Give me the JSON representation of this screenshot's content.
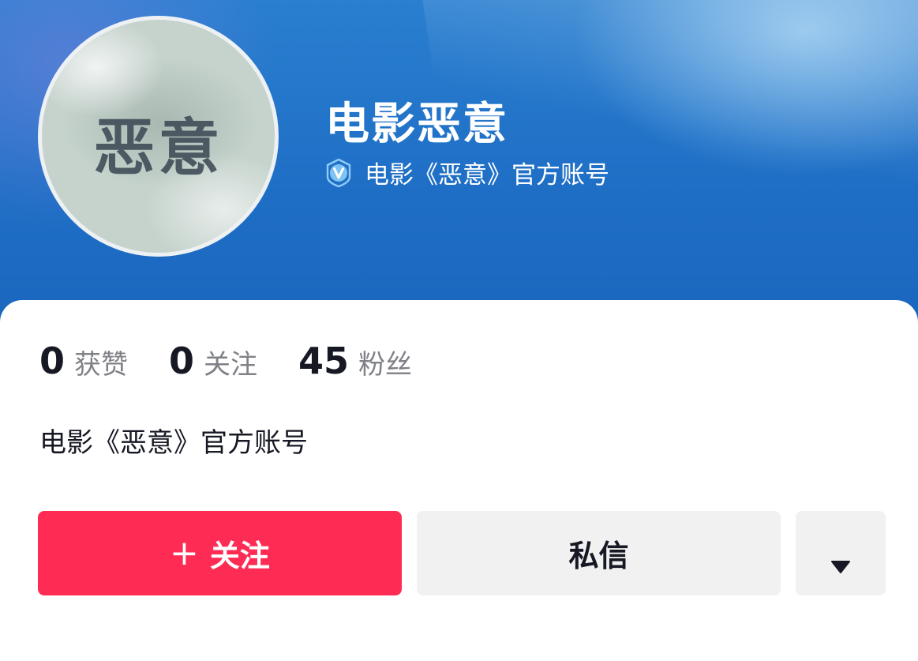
{
  "profile": {
    "name": "电影恶意",
    "avatar_text": "恶意",
    "verification": "电影《恶意》官方账号",
    "bio": "电影《恶意》官方账号"
  },
  "stats": [
    {
      "value": "0",
      "label": "获赞"
    },
    {
      "value": "0",
      "label": "关注"
    },
    {
      "value": "45",
      "label": "粉丝"
    }
  ],
  "actions": {
    "follow_icon": "+",
    "follow_label": "关注",
    "message_label": "私信",
    "more_icon": "triangle-down-icon"
  },
  "colors": {
    "follow": "#fe2c55",
    "header": "#1f6fc6",
    "verify_badge": "#7fc3f4"
  }
}
